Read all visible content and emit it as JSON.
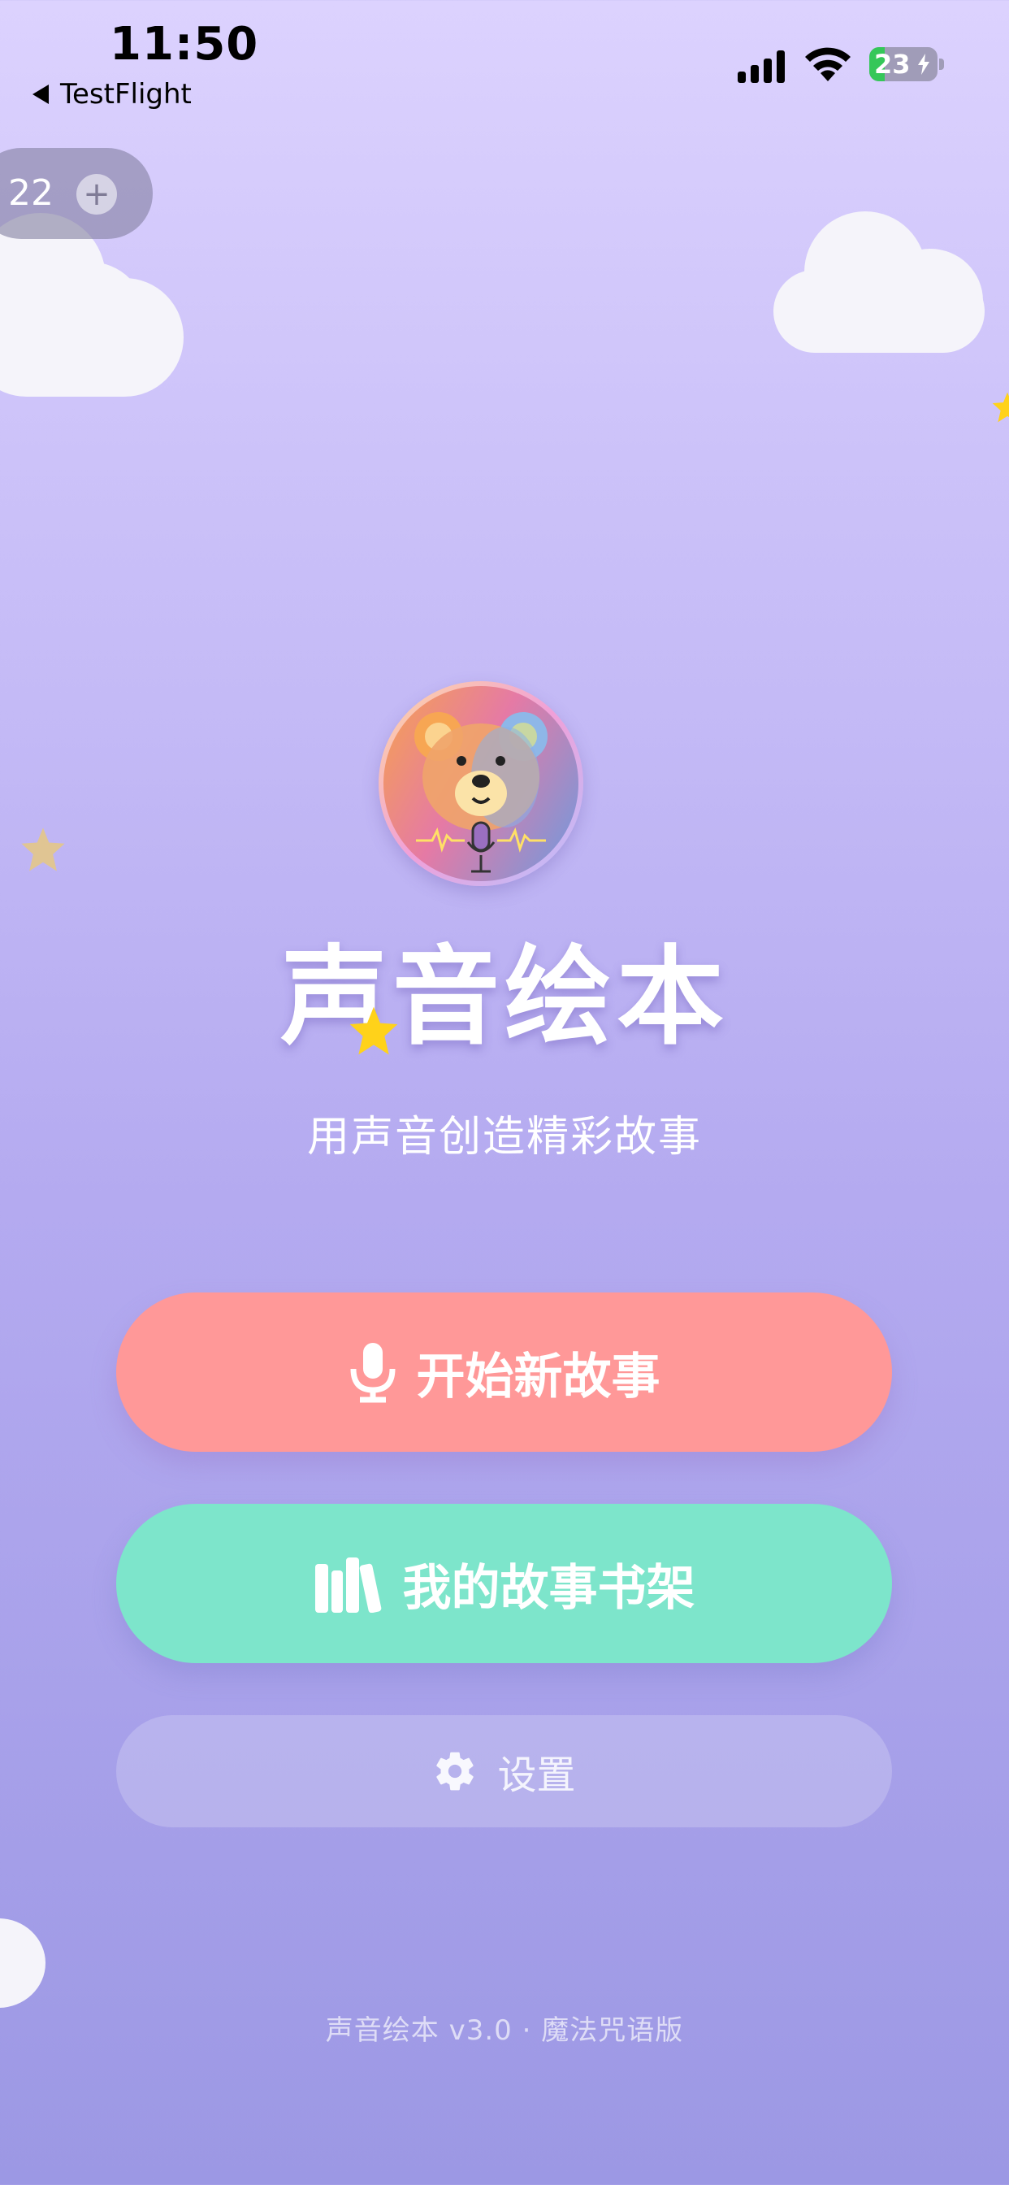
{
  "status_bar": {
    "time": "11:50",
    "back_label": "TestFlight",
    "battery_level": 23,
    "battery_text": "23"
  },
  "counter": {
    "value": "22",
    "add_icon": "plus-icon"
  },
  "app": {
    "title": "声音绘本",
    "subtitle": "用声音创造精彩故事",
    "logo": "bear-microphone-logo"
  },
  "buttons": {
    "start_label": "开始新故事",
    "start_icon": "microphone-icon",
    "shelf_label": "我的故事书架",
    "shelf_icon": "bookshelf-icon",
    "settings_label": "设置",
    "settings_icon": "gear-icon"
  },
  "footer": {
    "text": "声音绘本 v3.0 · 魔法咒语版"
  },
  "colors": {
    "start_button": "#ff9898",
    "shelf_button": "#7de5cb",
    "star": "#ffd21a"
  }
}
